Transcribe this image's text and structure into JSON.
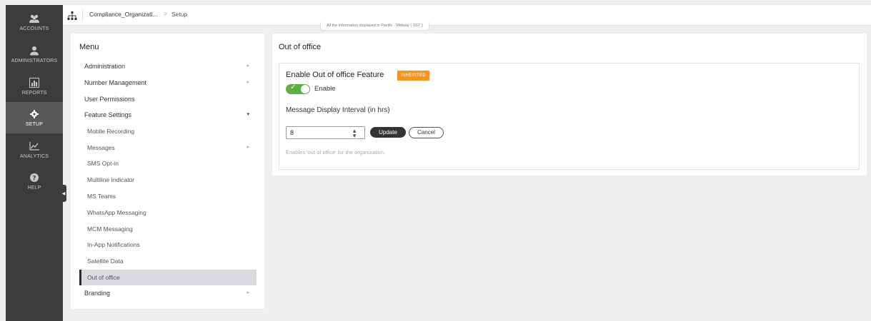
{
  "leftnav": {
    "items": [
      {
        "label": "ACCOUNTS",
        "icon": "users-icon"
      },
      {
        "label": "ADMINISTRATORS",
        "icon": "admin-icon"
      },
      {
        "label": "REPORTS",
        "icon": "bar-chart-icon"
      },
      {
        "label": "SETUP",
        "icon": "gear-icon",
        "active": true
      },
      {
        "label": "ANALYTICS",
        "icon": "line-chart-icon"
      },
      {
        "label": "HELP",
        "icon": "help-icon"
      }
    ]
  },
  "topbar": {
    "org_icon": "org-tree-icon",
    "org_name": "Compliance_Organizati...",
    "separator": ">",
    "page": "Setup",
    "timezone_note": "All the information displayed in Pacific - Midway ( SST )"
  },
  "menu": {
    "title": "Menu",
    "items": [
      {
        "label": "Administration",
        "chevron": "right"
      },
      {
        "label": "Number Management",
        "chevron": "right"
      },
      {
        "label": "User Permissions"
      },
      {
        "label": "Feature Settings",
        "chevron": "down"
      },
      {
        "label": "Mobile Recording",
        "sub": true
      },
      {
        "label": "Messages",
        "sub": true,
        "chevron": "right"
      },
      {
        "label": "SMS Opt-in",
        "sub": true
      },
      {
        "label": "Multiline Indicator",
        "sub": true
      },
      {
        "label": "MS Teams",
        "sub": true
      },
      {
        "label": "WhatsApp Messaging",
        "sub": true
      },
      {
        "label": "MCM Messaging",
        "sub": true
      },
      {
        "label": "In-App Notifications",
        "sub": true
      },
      {
        "label": "Satellite Data",
        "sub": true
      },
      {
        "label": "Out of office",
        "sub": true,
        "active": true
      },
      {
        "label": "Branding",
        "chevron": "right"
      }
    ]
  },
  "content": {
    "title": "Out of office",
    "feature_title": "Enable Out of office Feature",
    "badge": "INHERITED",
    "toggle_label": "Enable",
    "toggle_on": true,
    "interval_label": "Message Display Interval (in hrs)",
    "interval_value": "8",
    "update_label": "Update",
    "cancel_label": "Cancel",
    "help_text": "Enables 'out of office' for the organization."
  },
  "colors": {
    "nav_bg": "#3c3c3c",
    "badge": "#f7941d",
    "toggle_on": "#5fb043"
  }
}
